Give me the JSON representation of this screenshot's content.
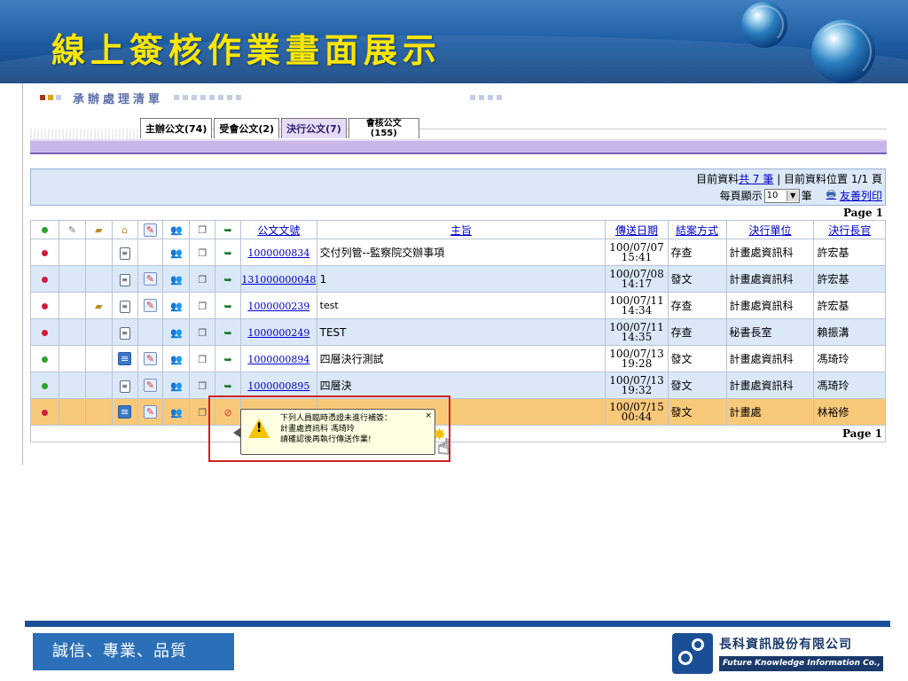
{
  "slide": {
    "title": "線上簽核作業畫面展示",
    "slogan": "誠信、專業、品質",
    "company_name": "長科資訊股份有限公司",
    "company_name_en": "Future Knowledge Information Co.,"
  },
  "app": {
    "section_title": "承辦處理清單",
    "tabs": [
      {
        "label": "主辦公文(74)"
      },
      {
        "label": "受會公文(2)"
      },
      {
        "label": "決行公文(7)",
        "active": true
      },
      {
        "label_line1": "會核公文",
        "label_line2": "(155)"
      }
    ],
    "info": {
      "prefix": "目前資料",
      "count_link": "共 7 筆",
      "position_text": "目前資料位置 1/1 頁",
      "per_page_prefix": "每頁顯示",
      "per_page_value": "10",
      "per_page_suffix": "筆",
      "print_link": "友善列印"
    },
    "page_label": "Page 1",
    "columns": [
      "公文文號",
      "主旨",
      "傳送日期",
      "結案方式",
      "決行單位",
      "決行長官"
    ],
    "rows": [
      {
        "status": "red",
        "doc_no": "1000000834",
        "subject": "交付列管--監察院交辦事項",
        "date": "100/07/07",
        "time": "15:41",
        "closing": "存查",
        "unit": "計畫處資訊科",
        "officer": "許宏基"
      },
      {
        "status": "red",
        "doc_no": "131000000048",
        "subject": "1",
        "date": "100/07/08",
        "time": "14:17",
        "closing": "發文",
        "unit": "計畫處資訊科",
        "officer": "許宏基"
      },
      {
        "status": "red",
        "doc_no": "1000000239",
        "subject": "test",
        "date": "100/07/11",
        "time": "14:34",
        "closing": "存查",
        "unit": "計畫處資訊科",
        "officer": "許宏基"
      },
      {
        "status": "red",
        "doc_no": "1000000249",
        "subject": "TEST",
        "date": "100/07/11",
        "time": "14:35",
        "closing": "存查",
        "unit": "秘書長室",
        "officer": "賴振溝"
      },
      {
        "status": "green",
        "doc_no": "1000000894",
        "subject": "四層決行測試",
        "date": "100/07/13",
        "time": "19:28",
        "closing": "發文",
        "unit": "計畫處資訊科",
        "officer": "馮琦玲"
      },
      {
        "status": "green",
        "doc_no": "1000000895",
        "subject": "四層決",
        "date": "100/07/13",
        "time": "19:32",
        "closing": "發文",
        "unit": "計畫處資訊科",
        "officer": "馮琦玲"
      },
      {
        "status": "red",
        "doc_no": "",
        "subject": "",
        "date": "100/07/15",
        "time": "00:44",
        "closing": "發文",
        "unit": "計畫處",
        "officer": "林裕修"
      }
    ],
    "tooltip": {
      "line1": "下列人員臨時憑證未進行補簽：",
      "line2": "計畫處資訊科 馮琦玲",
      "line3": "請確認後再執行傳送作業!",
      "close": "×"
    },
    "colors": {
      "status_red": "#d11a3a",
      "status_green": "#2aa52a",
      "selected_row": "#f9c97a",
      "stripe": "#dbe8f8"
    }
  }
}
